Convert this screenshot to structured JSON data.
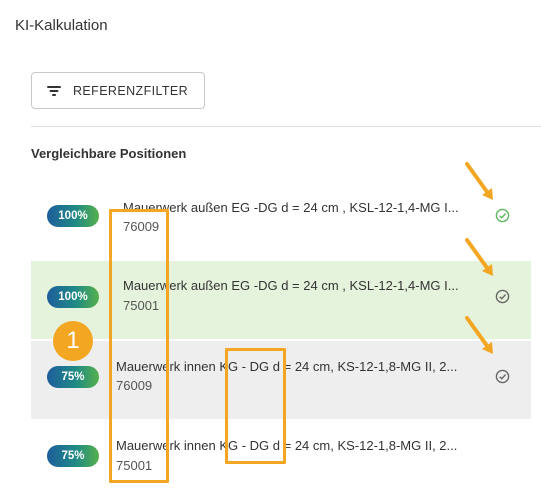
{
  "title": "KI-Kalkulation",
  "filter_button": {
    "label": "REFERENZFILTER",
    "icon": "filter-list-icon"
  },
  "section_title": "Vergleichbare Positionen",
  "positions": [
    {
      "score": "100%",
      "description": "Mauerwerk außen EG -DG d = 24 cm , KSL-12-1,4-MG I...",
      "code": "76009",
      "status_icon": "check-circle-icon",
      "status_color": "#5cb85c"
    },
    {
      "score": "100%",
      "description": "Mauerwerk außen EG -DG d = 24 cm , KSL-12-1,4-MG I...",
      "code": "75001",
      "status_icon": "check-circle-icon",
      "status_color": "#666666"
    },
    {
      "score": "75%",
      "description": "Mauerwerk innen KG - DG d = 24 cm, KS-12-1,8-MG II, 2...",
      "code": "76009",
      "status_icon": "check-circle-icon",
      "status_color": "#666666"
    },
    {
      "score": "75%",
      "description": "Mauerwerk innen KG - DG d = 24 cm, KS-12-1,8-MG II, 2...",
      "code": "75001"
    }
  ],
  "annotation": {
    "number": "1",
    "color": "#f2a622"
  },
  "colors": {
    "selected_row": "#e6f3dc",
    "hover_row": "#eeeeee",
    "badge_start": "#1f5d9c",
    "badge_end": "#56b04a"
  }
}
